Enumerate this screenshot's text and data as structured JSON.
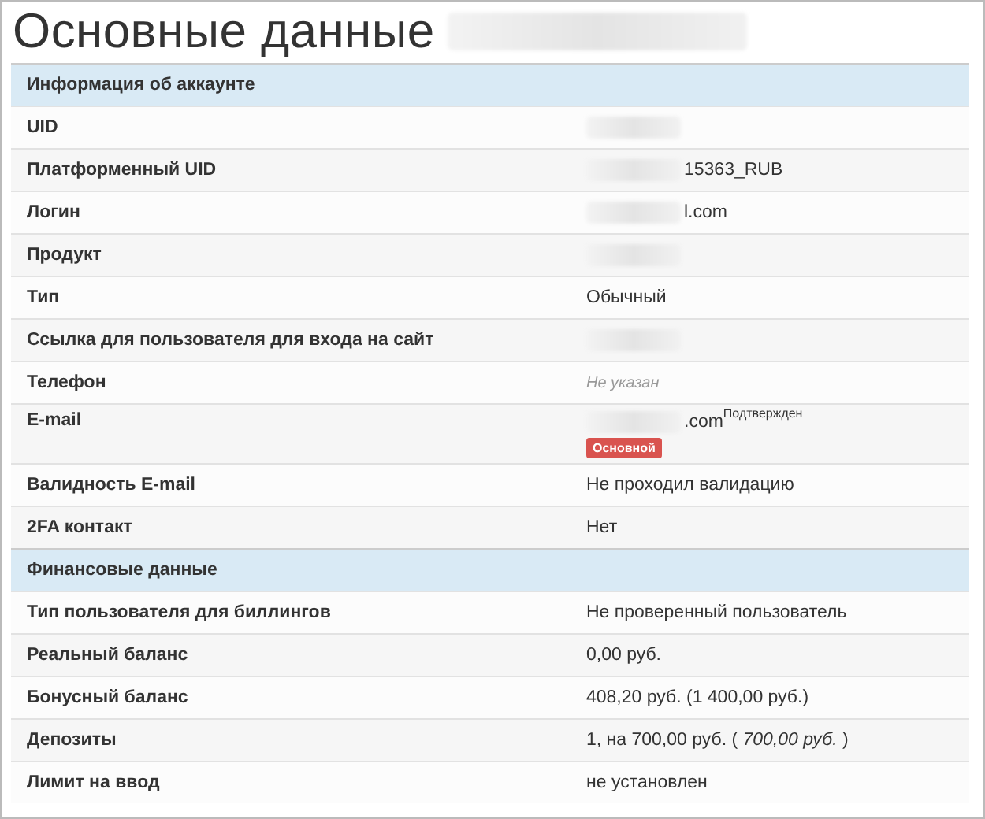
{
  "page": {
    "title": "Основные данные",
    "title_redacted": true
  },
  "sections": [
    {
      "title": "Информация об аккаунте",
      "rows": [
        {
          "label": "UID",
          "redacted": true
        },
        {
          "label": "Платформенный UID",
          "redacted": true,
          "value": "15363_RUB"
        },
        {
          "label": "Логин",
          "redacted": true,
          "value": "l.com"
        },
        {
          "label": "Продукт",
          "redacted": true
        },
        {
          "label": "Тип",
          "value": "Обычный"
        },
        {
          "label": "Ссылка для пользователя для входа на сайт",
          "redacted": true
        },
        {
          "label": "Телефон",
          "value": "Не указан",
          "muted": true
        },
        {
          "label": "E-mail",
          "redacted": true,
          "value": ".com",
          "note": "Подтвержден",
          "badge": "Основной"
        },
        {
          "label": "Валидность E-mail",
          "value": "Не проходил валидацию"
        },
        {
          "label": "2FA контакт",
          "value": "Нет"
        }
      ]
    },
    {
      "title": "Финансовые данные",
      "rows": [
        {
          "label": "Тип пользователя для биллингов",
          "value": "Не проверенный пользователь"
        },
        {
          "label": "Реальный баланс",
          "value": "0,00 руб."
        },
        {
          "label": "Бонусный баланс",
          "value": "408,20 руб. (1 400,00 руб.)"
        },
        {
          "label": "Депозиты",
          "value": "1, на 700,00 руб. ( *700,00 руб.* )"
        },
        {
          "label": "Лимит на ввод",
          "value": "не установлен"
        }
      ]
    }
  ]
}
